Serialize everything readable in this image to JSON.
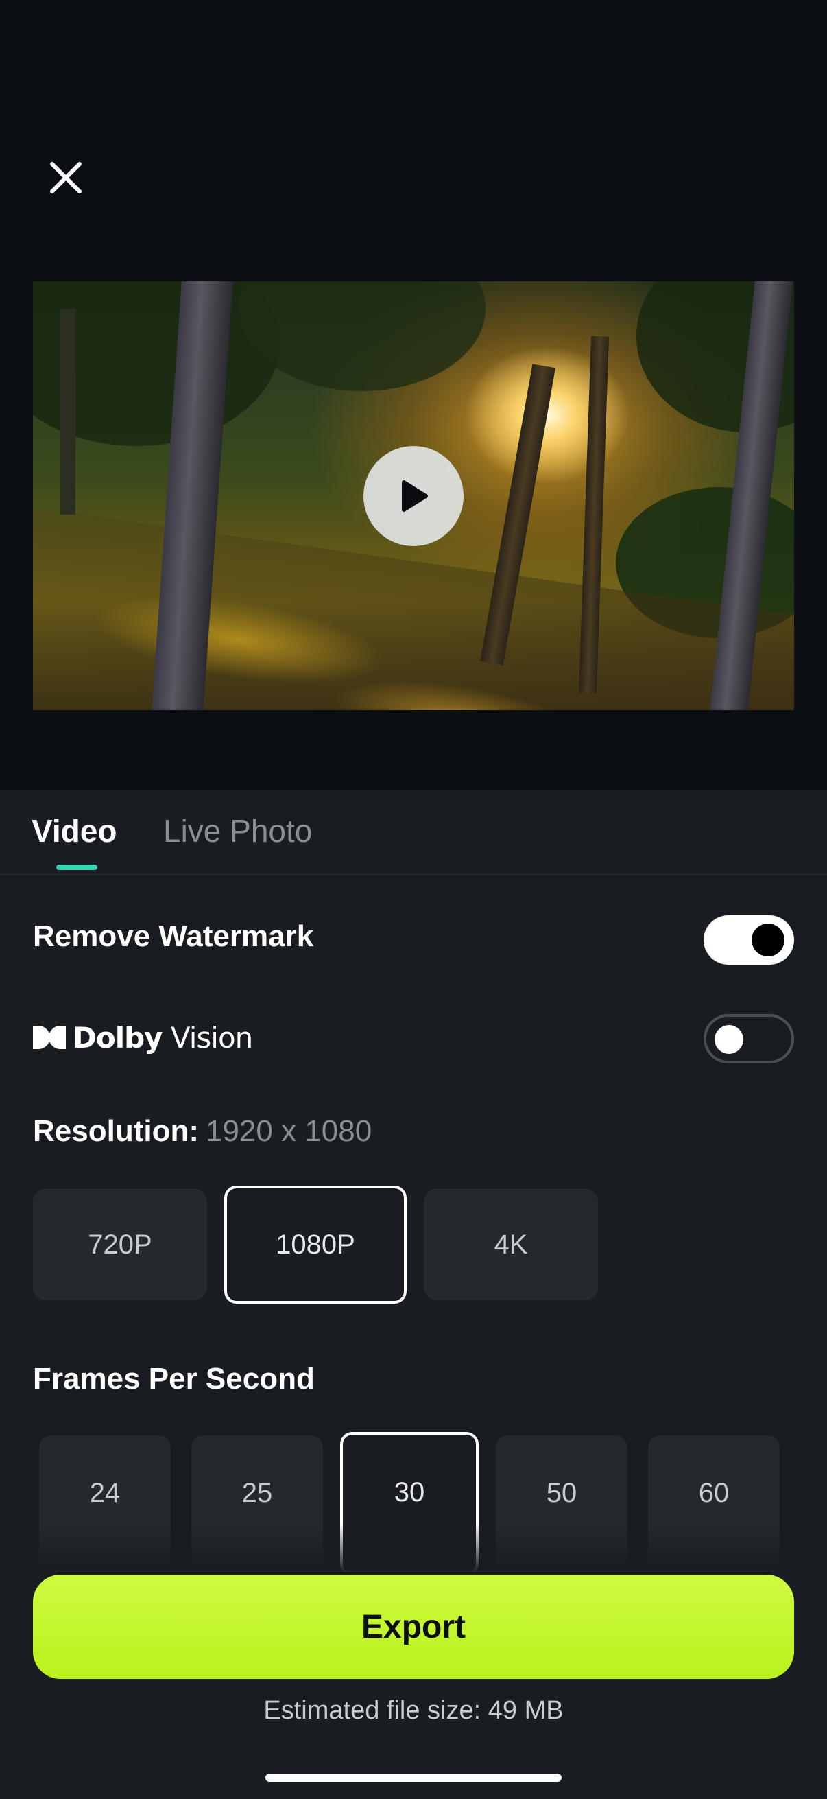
{
  "icons": {
    "close": "close-icon",
    "play": "play-icon",
    "dolby": "dolby-double-d-icon"
  },
  "tabs": [
    {
      "label": "Video",
      "active": true
    },
    {
      "label": "Live Photo",
      "active": false
    }
  ],
  "settings": {
    "remove_watermark": {
      "label": "Remove Watermark",
      "enabled": true
    },
    "dolby_vision": {
      "brand": "Dolby",
      "product": "Vision",
      "enabled": false
    }
  },
  "resolution": {
    "label": "Resolution:",
    "value": "1920 x 1080",
    "options": [
      "720P",
      "1080P",
      "4K"
    ],
    "selected": "1080P"
  },
  "fps": {
    "label": "Frames Per Second",
    "options": [
      "24",
      "25",
      "30",
      "50",
      "60"
    ],
    "selected": "30"
  },
  "export": {
    "button_label": "Export",
    "estimate": "Estimated file size: 49 MB"
  },
  "colors": {
    "accent_tab": "#37d5b3",
    "export_button": "#c4f72d",
    "background": "#191c20"
  }
}
